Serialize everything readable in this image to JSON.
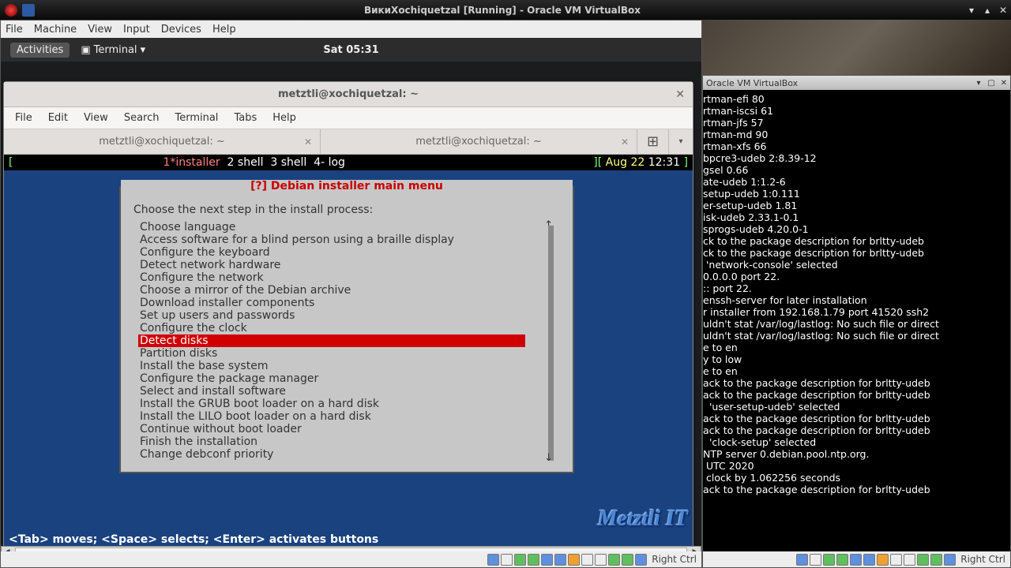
{
  "host_title": "ВикиXochiquetzal [Running] - Oracle VM VirtualBox",
  "vm_menu": [
    "File",
    "Machine",
    "View",
    "Input",
    "Devices",
    "Help"
  ],
  "topbar": {
    "activities": "Activities",
    "app": "Terminal",
    "time": "Sat 05:31"
  },
  "twin": {
    "title": "metztli@xochiquetzal: ~",
    "menu": [
      "File",
      "Edit",
      "View",
      "Search",
      "Terminal",
      "Tabs",
      "Help"
    ],
    "tabs": [
      "metztli@xochiquetzal: ~",
      "metztli@xochiquetzal: ~"
    ]
  },
  "status": {
    "lb": "[",
    "s1": "1*installer",
    "s2": "  2 shell  3 shell  4- log",
    "rb": "][",
    "date": " Aug 22 ",
    "time": "12:31",
    "end": " ]"
  },
  "dialog": {
    "title": "[?] Debian installer main menu",
    "prompt": "Choose the next step in the install process:",
    "items": [
      "Choose language",
      "Access software for a blind person using a braille display",
      "Configure the keyboard",
      "Detect network hardware",
      "Configure the network",
      "Choose a mirror of the Debian archive",
      "Download installer components",
      "Set up users and passwords",
      "Configure the clock",
      "Detect disks",
      "Partition disks",
      "Install the base system",
      "Configure the package manager",
      "Select and install software",
      "Install the GRUB boot loader on a hard disk",
      "Install the LILO boot loader on a hard disk",
      "Continue without boot loader",
      "Finish the installation",
      "Change debconf priority"
    ],
    "selected": 9
  },
  "hint": "<Tab> moves; <Space> selects; <Enter> activates buttons",
  "brand": "Metztli IT",
  "rctrl": "Right Ctrl",
  "vm2_title": "Oracle VM VirtualBox",
  "vm2_log": [
    "rtman-efi 80",
    "rtman-iscsi 61",
    "rtman-jfs 57",
    "rtman-md 90",
    "rtman-xfs 66",
    "bpcre3-udeb 2:8.39-12",
    "gsel 0.66",
    "ate-udeb 1:1.2-6",
    "setup-udeb 1:0.111",
    "er-setup-udeb 1.81",
    "isk-udeb 2.33.1-0.1",
    "sprogs-udeb 4.20.0-1",
    "ck to the package description for brltty-udeb",
    "ck to the package description for brltty-udeb",
    " 'network-console' selected",
    "0.0.0.0 port 22.",
    ":: port 22.",
    "enssh-server for later installation",
    "r installer from 192.168.1.79 port 41520 ssh2",
    "uldn't stat /var/log/lastlog: No such file or direct",
    "",
    "uldn't stat /var/log/lastlog: No such file or direct",
    "",
    "e to en",
    "y to low",
    "e to en",
    "ack to the package description for brltty-udeb",
    "ack to the package description for brltty-udeb",
    "  'user-setup-udeb' selected",
    "ack to the package description for brltty-udeb",
    "ack to the package description for brltty-udeb",
    "  'clock-setup' selected",
    "NTP server 0.debian.pool.ntp.org.",
    " UTC 2020",
    " clock by 1.062256 seconds",
    "ack to the package description for brltty-udeb"
  ]
}
